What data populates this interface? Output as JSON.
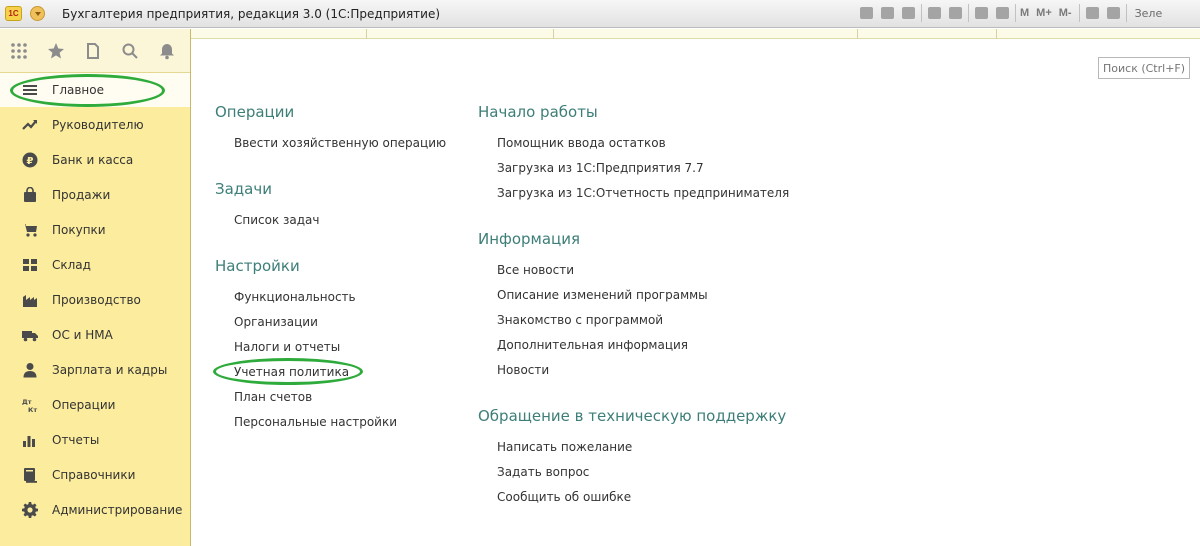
{
  "window": {
    "logo": "1С",
    "title": "Бухгалтерия предприятия, редакция 3.0  (1С:Предприятие)",
    "memory_buttons": [
      "M",
      "M+",
      "M-"
    ],
    "user": "Зеле"
  },
  "search": {
    "placeholder": "Поиск (Ctrl+F)"
  },
  "sidebar": {
    "items": [
      {
        "label": "Главное",
        "icon": "menu-icon"
      },
      {
        "label": "Руководителю",
        "icon": "trend-icon"
      },
      {
        "label": "Банк и касса",
        "icon": "ruble-icon"
      },
      {
        "label": "Продажи",
        "icon": "bag-icon"
      },
      {
        "label": "Покупки",
        "icon": "cart-icon"
      },
      {
        "label": "Склад",
        "icon": "warehouse-icon"
      },
      {
        "label": "Производство",
        "icon": "factory-icon"
      },
      {
        "label": "ОС и НМА",
        "icon": "truck-icon"
      },
      {
        "label": "Зарплата и кадры",
        "icon": "person-icon"
      },
      {
        "label": "Операции",
        "icon": "dt-kt-icon"
      },
      {
        "label": "Отчеты",
        "icon": "bar-chart-icon"
      },
      {
        "label": "Справочники",
        "icon": "book-icon"
      },
      {
        "label": "Администрирование",
        "icon": "gear-icon"
      }
    ]
  },
  "left_sections": [
    {
      "title": "Операции",
      "links": [
        "Ввести хозяйственную операцию"
      ]
    },
    {
      "title": "Задачи",
      "links": [
        "Список задач"
      ]
    },
    {
      "title": "Настройки",
      "links": [
        "Функциональность",
        "Организации",
        "Налоги и отчеты",
        "Учетная политика",
        "План счетов",
        "Персональные настройки"
      ]
    }
  ],
  "right_sections": [
    {
      "title": "Начало работы",
      "links": [
        "Помощник ввода остатков",
        "Загрузка из 1С:Предприятия 7.7",
        "Загрузка из 1С:Отчетность предпринимателя"
      ]
    },
    {
      "title": "Информация",
      "links": [
        "Все новости",
        "Описание изменений программы",
        "Знакомство с программой",
        "Дополнительная информация",
        "Новости"
      ]
    },
    {
      "title": "Обращение в техническую поддержку",
      "links": [
        "Написать пожелание",
        "Задать вопрос",
        "Сообщить об ошибке"
      ]
    }
  ],
  "colors": {
    "sidebar_bg": "#fbec9e",
    "section_title": "#3d7e78",
    "highlight_ellipse": "#2eab3b"
  }
}
